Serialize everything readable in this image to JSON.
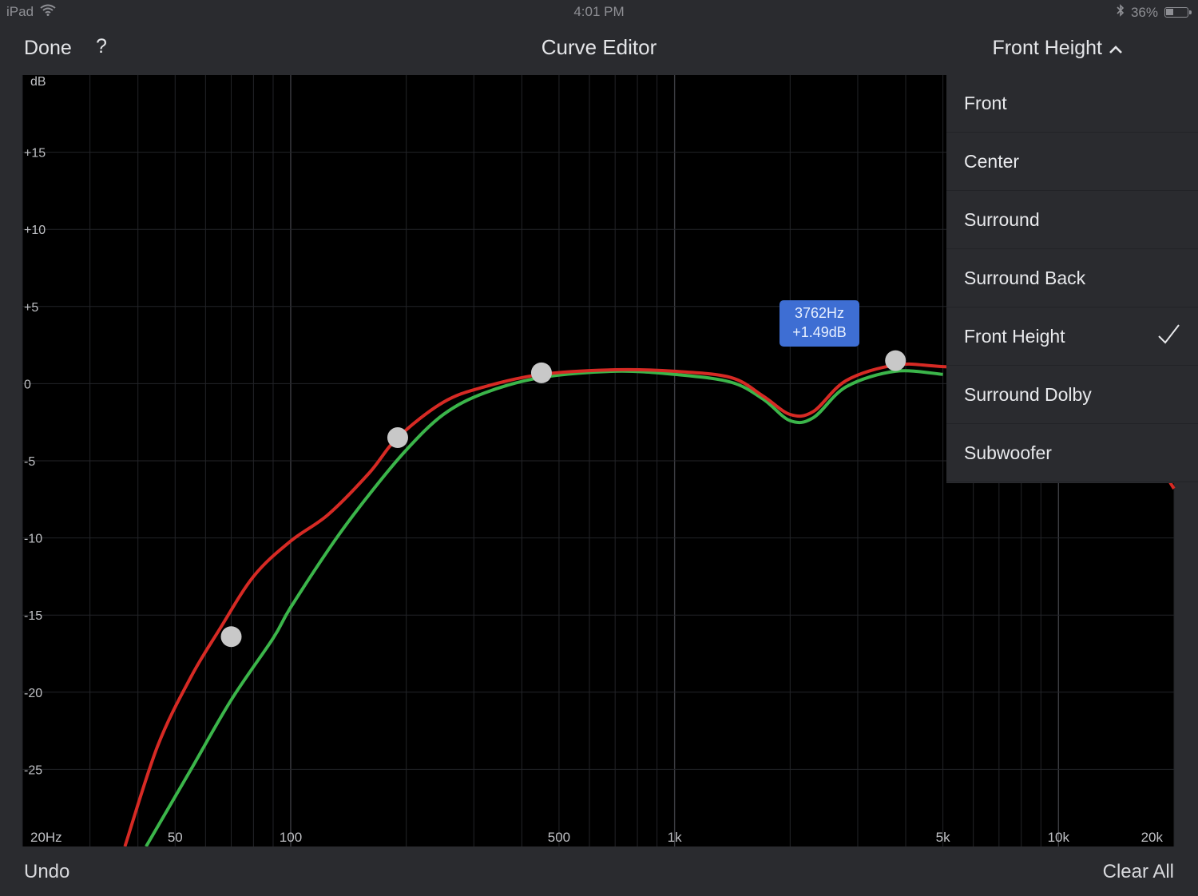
{
  "status": {
    "device": "iPad",
    "time": "4:01 PM",
    "battery": "36%",
    "battery_level": 0.36
  },
  "nav": {
    "done_label": "Done",
    "help_label": "?",
    "title": "Curve Editor",
    "channel_label": "Front Height"
  },
  "channels": [
    {
      "label": "Front",
      "selected": false
    },
    {
      "label": "Center",
      "selected": false
    },
    {
      "label": "Surround",
      "selected": false
    },
    {
      "label": "Surround Back",
      "selected": false
    },
    {
      "label": "Front Height",
      "selected": true
    },
    {
      "label": "Surround Dolby",
      "selected": false
    },
    {
      "label": "Subwoofer",
      "selected": false
    }
  ],
  "tooltip": {
    "freq": "3762Hz",
    "gain": "+1.49dB"
  },
  "bottom": {
    "undo_label": "Undo",
    "clear_all_label": "Clear All"
  },
  "colors": {
    "target_curve": "#d62a24",
    "measured_curve": "#3bb54a",
    "accent": "#3e6ed3",
    "control_point": "#c8c8c8"
  },
  "chart_data": {
    "type": "line",
    "ylabel": "dB",
    "x_scale": "log",
    "xlim": [
      20,
      20000
    ],
    "ylim": [
      -30,
      20
    ],
    "y_ticks": [
      {
        "value": 15,
        "label": "+15"
      },
      {
        "value": 10,
        "label": "+10"
      },
      {
        "value": 5,
        "label": "+5"
      },
      {
        "value": 0,
        "label": "0"
      },
      {
        "value": -5,
        "label": "-5"
      },
      {
        "value": -10,
        "label": "-10"
      },
      {
        "value": -15,
        "label": "-15"
      },
      {
        "value": -20,
        "label": "-20"
      },
      {
        "value": -25,
        "label": "-25"
      }
    ],
    "x_ticks": [
      {
        "value": 20,
        "label": "20Hz"
      },
      {
        "value": 50,
        "label": "50"
      },
      {
        "value": 100,
        "label": "100"
      },
      {
        "value": 500,
        "label": "500"
      },
      {
        "value": 1000,
        "label": "1k"
      },
      {
        "value": 5000,
        "label": "5k"
      },
      {
        "value": 10000,
        "label": "10k"
      },
      {
        "value": 20000,
        "label": "20k"
      }
    ],
    "grid": true,
    "series": [
      {
        "color": "#d62a24",
        "x": [
          37,
          45,
          55,
          65,
          80,
          100,
          125,
          160,
          190,
          250,
          320,
          450,
          700,
          1000,
          1400,
          1700,
          2000,
          2300,
          2800,
          3762,
          5000,
          10000,
          17000,
          20000
        ],
        "y": [
          -30,
          -23.5,
          -19,
          -16,
          -12.5,
          -10.2,
          -8.5,
          -5.8,
          -3.5,
          -1.2,
          -0.2,
          0.6,
          0.9,
          0.8,
          0.4,
          -0.8,
          -2.0,
          -1.8,
          0.2,
          1.2,
          1.1,
          0.5,
          -4.5,
          -6.8
        ]
      },
      {
        "color": "#3bb54a",
        "x": [
          42,
          55,
          70,
          90,
          100,
          130,
          160,
          200,
          250,
          320,
          450,
          700,
          1000,
          1400,
          1700,
          2000,
          2300,
          2800,
          3762,
          5000
        ],
        "y": [
          -30,
          -25,
          -20.5,
          -16.5,
          -14.5,
          -10.2,
          -7.2,
          -4.3,
          -2.0,
          -0.6,
          0.4,
          0.8,
          0.6,
          0.1,
          -1.0,
          -2.4,
          -2.2,
          -0.2,
          0.8,
          0.6
        ]
      }
    ],
    "control_points": [
      {
        "x": 70,
        "y": -16.4
      },
      {
        "x": 190,
        "y": -3.5
      },
      {
        "x": 450,
        "y": 0.7
      },
      {
        "x": 3762,
        "y": 1.49
      }
    ]
  }
}
